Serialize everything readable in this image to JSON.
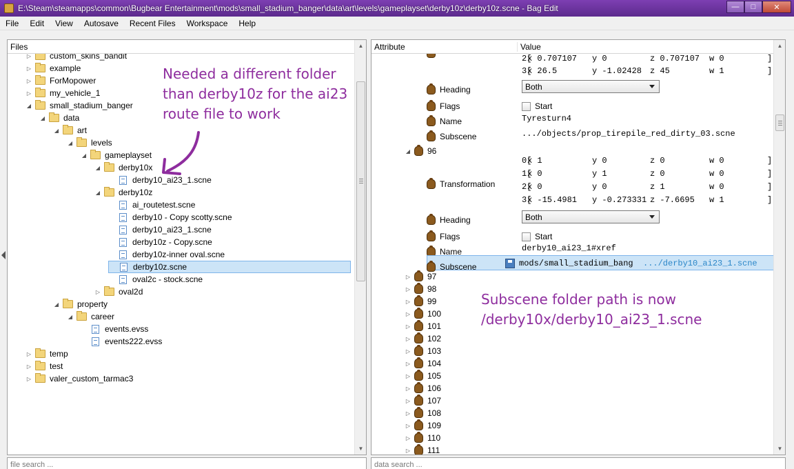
{
  "window": {
    "title": "E:\\Steam\\steamapps\\common\\Bugbear Entertainment\\mods\\small_stadium_banger\\data\\art\\levels\\gameplayset\\derby10z\\derby10z.scne - Bag Edit"
  },
  "menu": [
    "File",
    "Edit",
    "View",
    "Autosave",
    "Recent Files",
    "Workspace",
    "Help"
  ],
  "files_panel": {
    "header": "Files",
    "search_placeholder": "file search ...",
    "tree": [
      {
        "label": "custom_skins_bandit",
        "type": "folder",
        "expander": "collapsed"
      },
      {
        "label": "example",
        "type": "folder",
        "expander": "collapsed"
      },
      {
        "label": "ForMopower",
        "type": "folder",
        "expander": "collapsed"
      },
      {
        "label": "my_vehicle_1",
        "type": "folder",
        "expander": "collapsed"
      },
      {
        "label": "small_stadium_banger",
        "type": "folder",
        "expander": "expanded"
      },
      {
        "label": "data",
        "type": "folder",
        "expander": "expanded"
      },
      {
        "label": "art",
        "type": "folder",
        "expander": "expanded"
      },
      {
        "label": "levels",
        "type": "folder",
        "expander": "expanded"
      },
      {
        "label": "gameplayset",
        "type": "folder",
        "expander": "expanded"
      },
      {
        "label": "derby10x",
        "type": "folder",
        "expander": "expanded"
      },
      {
        "label": "derby10_ai23_1.scne",
        "type": "file",
        "expander": "none"
      },
      {
        "label": "derby10z",
        "type": "folder",
        "expander": "expanded"
      },
      {
        "label": "ai_routetest.scne",
        "type": "file",
        "expander": "none"
      },
      {
        "label": "derby10 - Copy scotty.scne",
        "type": "file",
        "expander": "none"
      },
      {
        "label": "derby10_ai23_1.scne",
        "type": "file",
        "expander": "none"
      },
      {
        "label": "derby10z - Copy.scne",
        "type": "file",
        "expander": "none"
      },
      {
        "label": "derby10z-inner oval.scne",
        "type": "file",
        "expander": "none"
      },
      {
        "label": "derby10z.scne",
        "type": "file",
        "expander": "none",
        "selected": true
      },
      {
        "label": "oval2c - stock.scne",
        "type": "file",
        "expander": "none"
      },
      {
        "label": "oval2d",
        "type": "folder",
        "expander": "collapsed"
      },
      {
        "label": "property",
        "type": "folder",
        "expander": "expanded"
      },
      {
        "label": "career",
        "type": "folder",
        "expander": "expanded"
      },
      {
        "label": "events.evss",
        "type": "file",
        "expander": "none"
      },
      {
        "label": "events222.evss",
        "type": "file",
        "expander": "none"
      },
      {
        "label": "temp",
        "type": "folder",
        "expander": "collapsed"
      },
      {
        "label": "test",
        "type": "folder",
        "expander": "collapsed"
      },
      {
        "label": "valer_custom_tarmac3",
        "type": "folder",
        "expander": "collapsed"
      }
    ]
  },
  "data_panel": {
    "col_attribute": "Attribute",
    "col_value": "Value",
    "search_placeholder": "data search ...",
    "matrix_top": [
      {
        "r": "2[",
        "x": "x 0.707107",
        "y": "y 0",
        "z": "z 0.707107",
        "w": "w 0",
        "end": "]"
      },
      {
        "r": "3[",
        "x": "x 26.5",
        "y": "y -1.02428",
        "z": "z 45",
        "w": "w 1",
        "end": "]"
      }
    ],
    "item_a": {
      "heading_label": "Heading",
      "heading_value": "Both",
      "flags_label": "Flags",
      "flags_value": "Start",
      "name_label": "Name",
      "name_value": "Tyresturn4",
      "subscene_label": "Subscene",
      "subscene_value": ".../objects/prop_tirepile_red_dirty_03.scne"
    },
    "node_96": "96",
    "item_b": {
      "transformation_label": "Transformation",
      "matrix": [
        {
          "r": "0[",
          "x": "x 1",
          "y": "y 0",
          "z": "z 0",
          "w": "w 0",
          "end": "]"
        },
        {
          "r": "1[",
          "x": "x 0",
          "y": "y 1",
          "z": "z 0",
          "w": "w 0",
          "end": "]"
        },
        {
          "r": "2[",
          "x": "x 0",
          "y": "y 0",
          "z": "z 1",
          "w": "w 0",
          "end": "]"
        },
        {
          "r": "3[",
          "x": "x -15.4981",
          "y": "y -0.273331",
          "z": "z -7.6695",
          "w": "w 1",
          "end": "]"
        }
      ],
      "heading_label": "Heading",
      "heading_value": "Both",
      "flags_label": "Flags",
      "flags_value": "Start",
      "name_label": "Name",
      "name_value": "derby10_ai23_1#xref",
      "subscene_label": "Subscene",
      "subscene_input": "mods/small_stadium_bang",
      "subscene_suffix": ".../derby10_ai23_1.scne"
    },
    "nodes": [
      "97",
      "98",
      "99",
      "100",
      "101",
      "102",
      "103",
      "104",
      "105",
      "106",
      "107",
      "108",
      "109",
      "110",
      "111"
    ]
  },
  "annotations": {
    "left": [
      "Needed a different folder",
      "than derby10z for the ai23",
      "route file to work"
    ],
    "right": [
      "Subscene folder path is now",
      "/derby10x/derby10_ai23_1.scne"
    ]
  },
  "colors": {
    "titlebar": "#6a3399",
    "annotation": "#8e2d9e",
    "selection": "#cce4f7"
  }
}
